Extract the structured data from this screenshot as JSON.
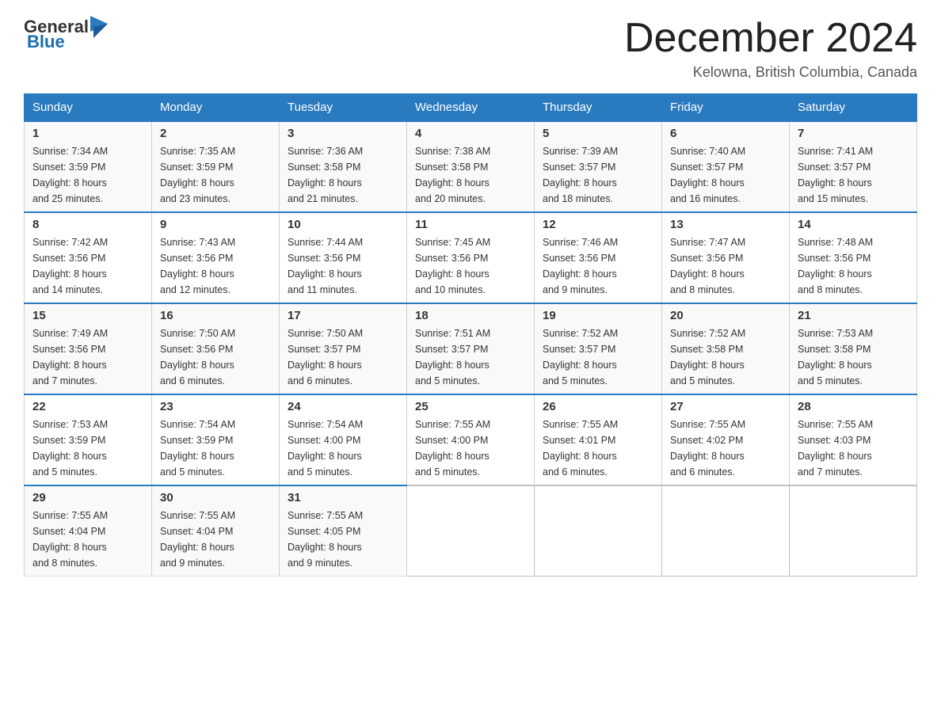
{
  "logo": {
    "text_general": "General",
    "text_blue": "Blue"
  },
  "title": {
    "month": "December 2024",
    "location": "Kelowna, British Columbia, Canada"
  },
  "days_of_week": [
    "Sunday",
    "Monday",
    "Tuesday",
    "Wednesday",
    "Thursday",
    "Friday",
    "Saturday"
  ],
  "weeks": [
    [
      {
        "day": "1",
        "sunrise": "7:34 AM",
        "sunset": "3:59 PM",
        "daylight": "8 hours and 25 minutes."
      },
      {
        "day": "2",
        "sunrise": "7:35 AM",
        "sunset": "3:59 PM",
        "daylight": "8 hours and 23 minutes."
      },
      {
        "day": "3",
        "sunrise": "7:36 AM",
        "sunset": "3:58 PM",
        "daylight": "8 hours and 21 minutes."
      },
      {
        "day": "4",
        "sunrise": "7:38 AM",
        "sunset": "3:58 PM",
        "daylight": "8 hours and 20 minutes."
      },
      {
        "day": "5",
        "sunrise": "7:39 AM",
        "sunset": "3:57 PM",
        "daylight": "8 hours and 18 minutes."
      },
      {
        "day": "6",
        "sunrise": "7:40 AM",
        "sunset": "3:57 PM",
        "daylight": "8 hours and 16 minutes."
      },
      {
        "day": "7",
        "sunrise": "7:41 AM",
        "sunset": "3:57 PM",
        "daylight": "8 hours and 15 minutes."
      }
    ],
    [
      {
        "day": "8",
        "sunrise": "7:42 AM",
        "sunset": "3:56 PM",
        "daylight": "8 hours and 14 minutes."
      },
      {
        "day": "9",
        "sunrise": "7:43 AM",
        "sunset": "3:56 PM",
        "daylight": "8 hours and 12 minutes."
      },
      {
        "day": "10",
        "sunrise": "7:44 AM",
        "sunset": "3:56 PM",
        "daylight": "8 hours and 11 minutes."
      },
      {
        "day": "11",
        "sunrise": "7:45 AM",
        "sunset": "3:56 PM",
        "daylight": "8 hours and 10 minutes."
      },
      {
        "day": "12",
        "sunrise": "7:46 AM",
        "sunset": "3:56 PM",
        "daylight": "8 hours and 9 minutes."
      },
      {
        "day": "13",
        "sunrise": "7:47 AM",
        "sunset": "3:56 PM",
        "daylight": "8 hours and 8 minutes."
      },
      {
        "day": "14",
        "sunrise": "7:48 AM",
        "sunset": "3:56 PM",
        "daylight": "8 hours and 8 minutes."
      }
    ],
    [
      {
        "day": "15",
        "sunrise": "7:49 AM",
        "sunset": "3:56 PM",
        "daylight": "8 hours and 7 minutes."
      },
      {
        "day": "16",
        "sunrise": "7:50 AM",
        "sunset": "3:56 PM",
        "daylight": "8 hours and 6 minutes."
      },
      {
        "day": "17",
        "sunrise": "7:50 AM",
        "sunset": "3:57 PM",
        "daylight": "8 hours and 6 minutes."
      },
      {
        "day": "18",
        "sunrise": "7:51 AM",
        "sunset": "3:57 PM",
        "daylight": "8 hours and 5 minutes."
      },
      {
        "day": "19",
        "sunrise": "7:52 AM",
        "sunset": "3:57 PM",
        "daylight": "8 hours and 5 minutes."
      },
      {
        "day": "20",
        "sunrise": "7:52 AM",
        "sunset": "3:58 PM",
        "daylight": "8 hours and 5 minutes."
      },
      {
        "day": "21",
        "sunrise": "7:53 AM",
        "sunset": "3:58 PM",
        "daylight": "8 hours and 5 minutes."
      }
    ],
    [
      {
        "day": "22",
        "sunrise": "7:53 AM",
        "sunset": "3:59 PM",
        "daylight": "8 hours and 5 minutes."
      },
      {
        "day": "23",
        "sunrise": "7:54 AM",
        "sunset": "3:59 PM",
        "daylight": "8 hours and 5 minutes."
      },
      {
        "day": "24",
        "sunrise": "7:54 AM",
        "sunset": "4:00 PM",
        "daylight": "8 hours and 5 minutes."
      },
      {
        "day": "25",
        "sunrise": "7:55 AM",
        "sunset": "4:00 PM",
        "daylight": "8 hours and 5 minutes."
      },
      {
        "day": "26",
        "sunrise": "7:55 AM",
        "sunset": "4:01 PM",
        "daylight": "8 hours and 6 minutes."
      },
      {
        "day": "27",
        "sunrise": "7:55 AM",
        "sunset": "4:02 PM",
        "daylight": "8 hours and 6 minutes."
      },
      {
        "day": "28",
        "sunrise": "7:55 AM",
        "sunset": "4:03 PM",
        "daylight": "8 hours and 7 minutes."
      }
    ],
    [
      {
        "day": "29",
        "sunrise": "7:55 AM",
        "sunset": "4:04 PM",
        "daylight": "8 hours and 8 minutes."
      },
      {
        "day": "30",
        "sunrise": "7:55 AM",
        "sunset": "4:04 PM",
        "daylight": "8 hours and 9 minutes."
      },
      {
        "day": "31",
        "sunrise": "7:55 AM",
        "sunset": "4:05 PM",
        "daylight": "8 hours and 9 minutes."
      },
      null,
      null,
      null,
      null
    ]
  ],
  "labels": {
    "sunrise": "Sunrise: ",
    "sunset": "Sunset: ",
    "daylight": "Daylight: "
  }
}
